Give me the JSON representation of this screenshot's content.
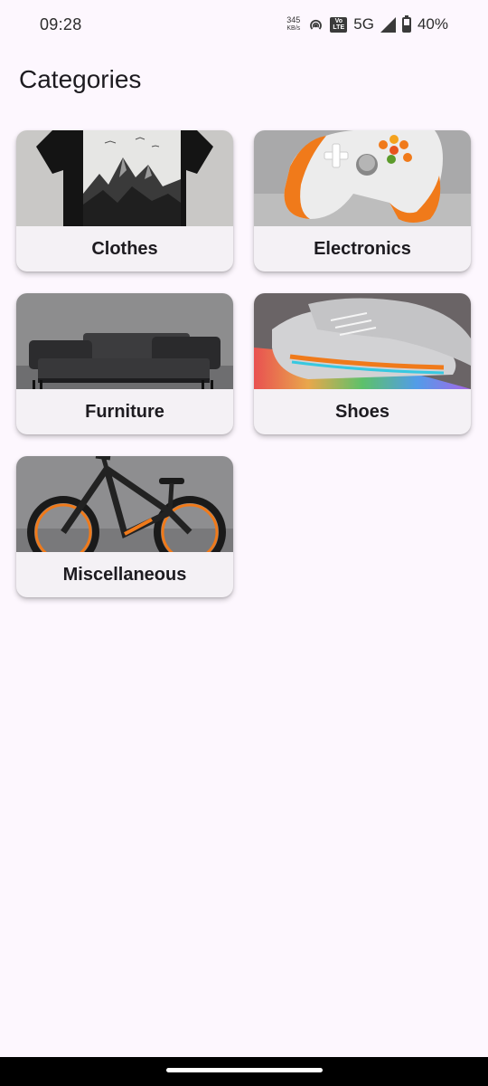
{
  "status_bar": {
    "time": "09:28",
    "speed_value": "345",
    "speed_unit": "KB/s",
    "volte_top": "Vo",
    "volte_bottom": "LTE",
    "network": "5G",
    "battery": "40%",
    "battery_level": 0.4
  },
  "page": {
    "title": "Categories"
  },
  "categories": [
    {
      "label": "Clothes",
      "image": "tshirt-image"
    },
    {
      "label": "Electronics",
      "image": "game-controller-image"
    },
    {
      "label": "Furniture",
      "image": "sofa-image"
    },
    {
      "label": "Shoes",
      "image": "sneakers-image"
    },
    {
      "label": "Miscellaneous",
      "image": "bicycle-image"
    }
  ],
  "colors": {
    "background": "#fdf7fe",
    "card": "#f4f1f5",
    "text": "#1d1b20",
    "accent_orange": "#f07a1a"
  }
}
